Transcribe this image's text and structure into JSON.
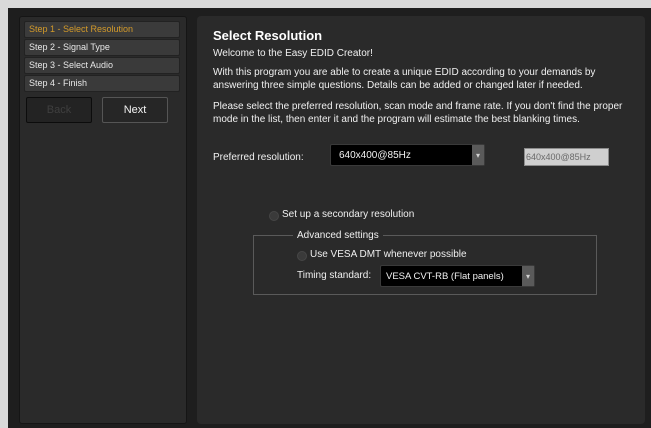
{
  "steps": [
    {
      "label": "Step 1 - Select Resolution",
      "active": true
    },
    {
      "label": "Step 2 - Signal Type",
      "active": false
    },
    {
      "label": "Step 3 - Select Audio",
      "active": false
    },
    {
      "label": "Step 4 - Finish",
      "active": false
    }
  ],
  "nav": {
    "back_label": "Back",
    "next_label": "Next"
  },
  "main": {
    "title": "Select Resolution",
    "welcome": "Welcome to the Easy EDID Creator!",
    "para1": "With this program you are able to create a unique EDID according to your demands by answering three simple questions. Details can be added or changed later if needed.",
    "para2": "Please select the preferred resolution, scan mode and frame rate. If you don't find the proper mode in the list, then enter it and the program will estimate the best blanking times.",
    "preferred_label": "Preferred resolution:",
    "preferred_value": "640x400@85Hz",
    "preferred_input_value": "640x400@85Hz",
    "secondary_label": "Set up a secondary resolution",
    "advanced": {
      "legend": "Advanced settings",
      "vesa_label": "Use VESA DMT whenever possible",
      "timing_label": "Timing standard:",
      "timing_value": "VESA CVT-RB (Flat panels)"
    }
  },
  "colors": {
    "accent": "#d39a2a",
    "background": "#1e1e1e",
    "panel": "#2a2a2a"
  }
}
